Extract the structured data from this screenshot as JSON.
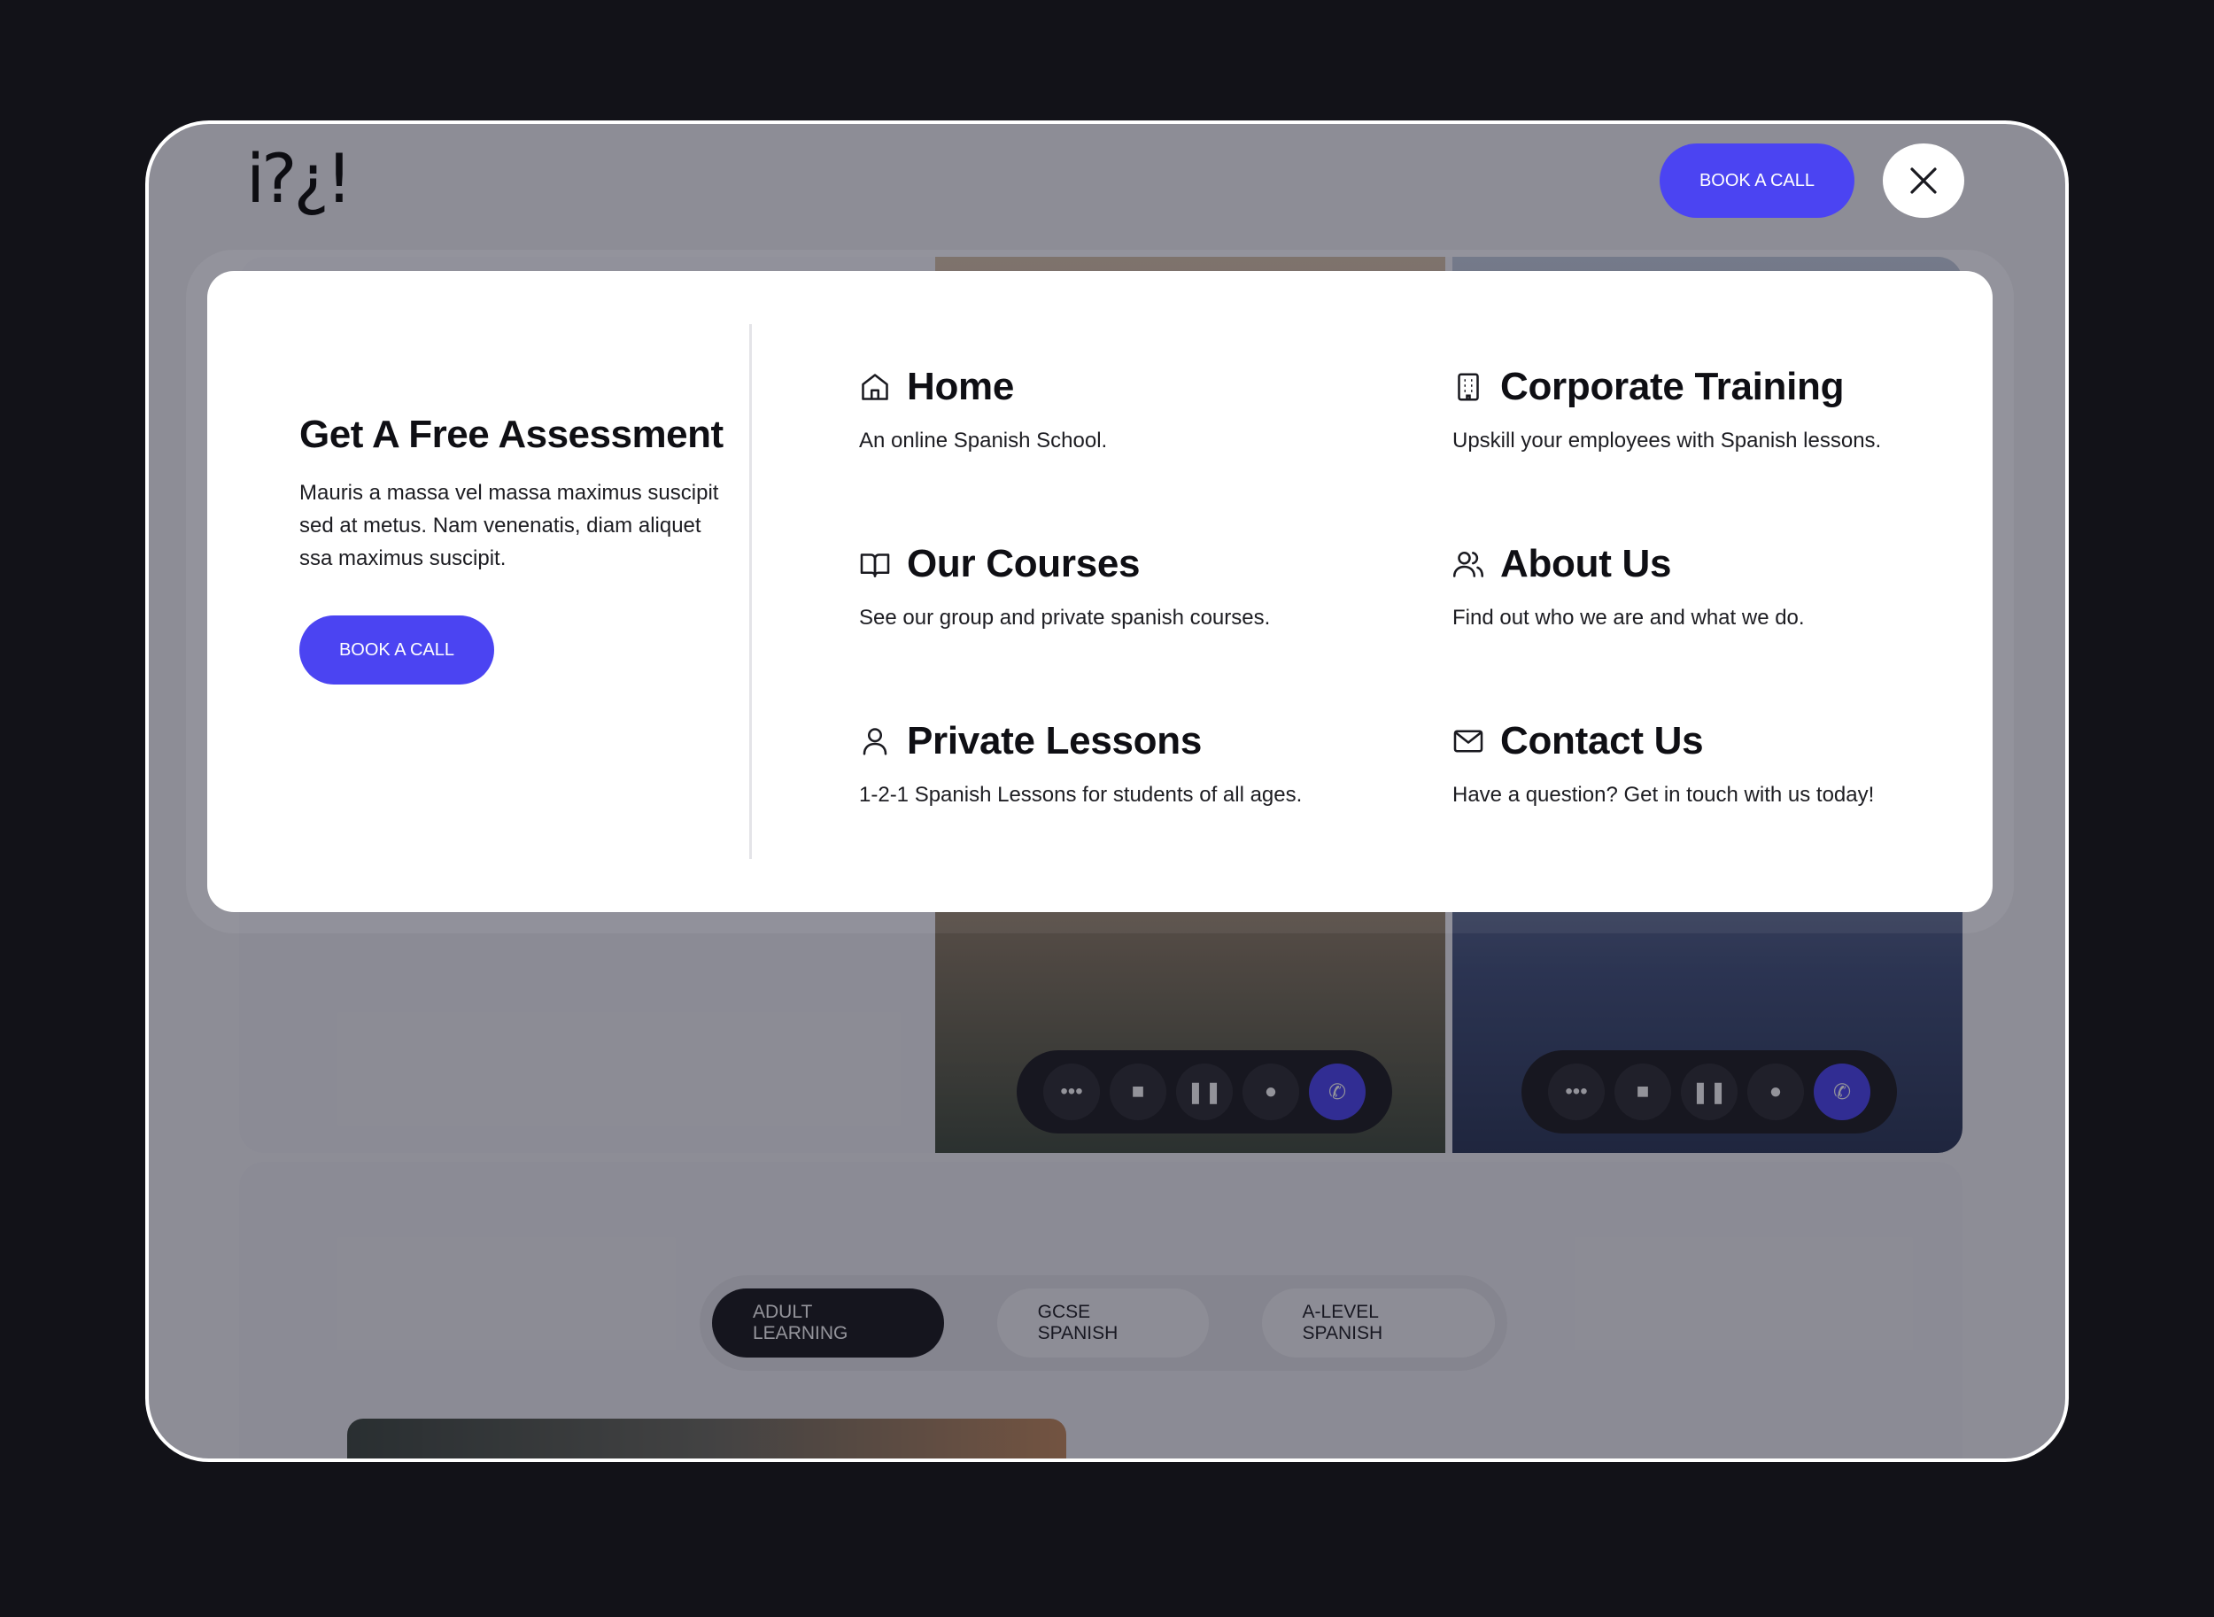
{
  "header": {
    "logo_text": "i?¿!",
    "book_label": "BOOK A CALL",
    "close_icon": "close-icon"
  },
  "menu": {
    "assessment": {
      "title": "Get A Free Assessment",
      "body": "Mauris a massa vel massa maximus suscipit sed at metus. Nam venenatis, diam aliquet ssa maximus suscipit.",
      "book_label": "BOOK A CALL"
    },
    "items": [
      {
        "icon": "home-icon",
        "title": "Home",
        "desc": "An online Spanish School."
      },
      {
        "icon": "building-icon",
        "title": "Corporate Training",
        "desc": "Upskill your employees with Spanish lessons."
      },
      {
        "icon": "book-open-icon",
        "title": "Our Courses",
        "desc": "See our group and private spanish courses."
      },
      {
        "icon": "users-icon",
        "title": "About Us",
        "desc": "Find out who we are and what we do."
      },
      {
        "icon": "user-icon",
        "title": "Private Lessons",
        "desc": "1-2-1 Spanish Lessons for students of all ages."
      },
      {
        "icon": "mail-icon",
        "title": "Contact Us",
        "desc": "Have a question? Get in touch with us today!"
      }
    ]
  },
  "background": {
    "call_controls": [
      "more-icon",
      "video-icon",
      "pause-icon",
      "mic-icon",
      "phone-icon"
    ],
    "tabs": [
      {
        "label": "ADULT LEARNING",
        "active": true
      },
      {
        "label": "GCSE SPANISH",
        "active": false
      },
      {
        "label": "A-LEVEL SPANISH",
        "active": false
      }
    ]
  },
  "colors": {
    "accent": "#4b44f2",
    "frame_bg": "#121218",
    "text": "#0f0f14"
  }
}
